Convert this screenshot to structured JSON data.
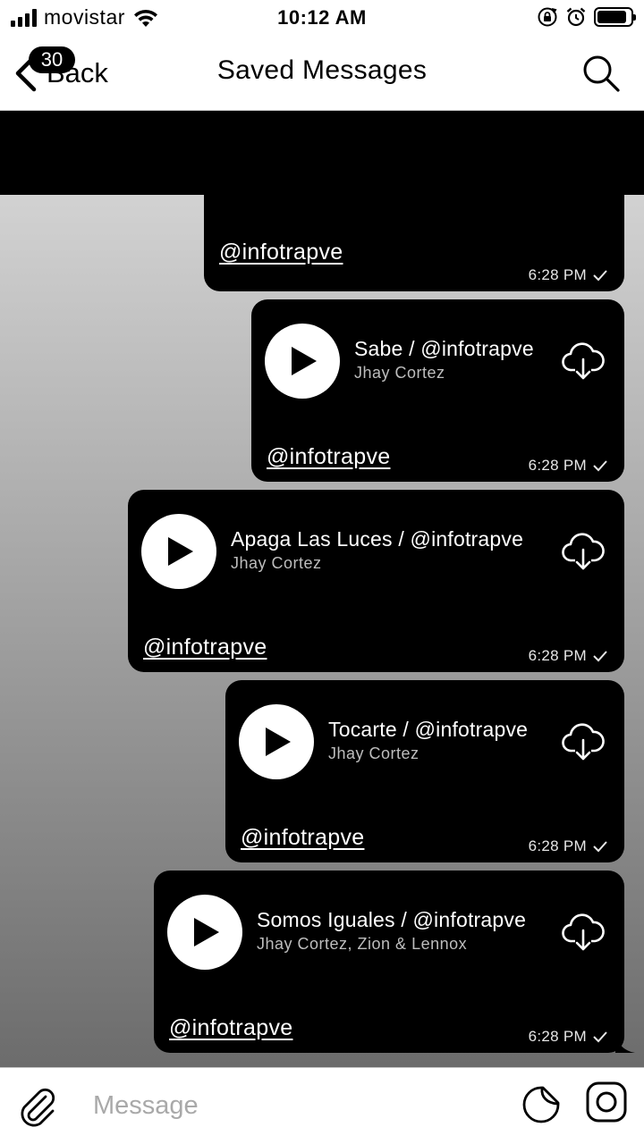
{
  "status_bar": {
    "carrier": "movistar",
    "time": "10:12 AM",
    "signal_bars": 4,
    "battery_level": 0.9
  },
  "nav": {
    "back_label": "Back",
    "unread_count": "30",
    "title": "Saved Messages"
  },
  "messages": [
    {
      "title": "",
      "artist": "",
      "caption": "@infotrapve",
      "time": "6:28 PM",
      "read": true
    },
    {
      "title": "Sabe / @infotrapve",
      "artist": "Jhay Cortez",
      "caption": "@infotrapve",
      "time": "6:28 PM",
      "read": true
    },
    {
      "title": "Apaga Las Luces / @infotrapve",
      "artist": "Jhay Cortez",
      "caption": "@infotrapve",
      "time": "6:28 PM",
      "read": true
    },
    {
      "title": "Tocarte / @infotrapve",
      "artist": "Jhay Cortez",
      "caption": "@infotrapve",
      "time": "6:28 PM",
      "read": true
    },
    {
      "title": "Somos Iguales / @infotrapve",
      "artist": "Jhay Cortez, Zion & Lennox",
      "caption": "@infotrapve",
      "time": "6:28 PM",
      "read": true
    }
  ],
  "composer": {
    "placeholder": "Message"
  },
  "icons": {
    "wifi": "wifi-icon",
    "rotation_lock": "rotation-lock-icon",
    "alarm": "alarm-icon",
    "search": "search-icon",
    "download": "cloud-download-icon",
    "attach": "paperclip-icon",
    "sticker": "sticker-icon",
    "camera": "camera-icon"
  }
}
